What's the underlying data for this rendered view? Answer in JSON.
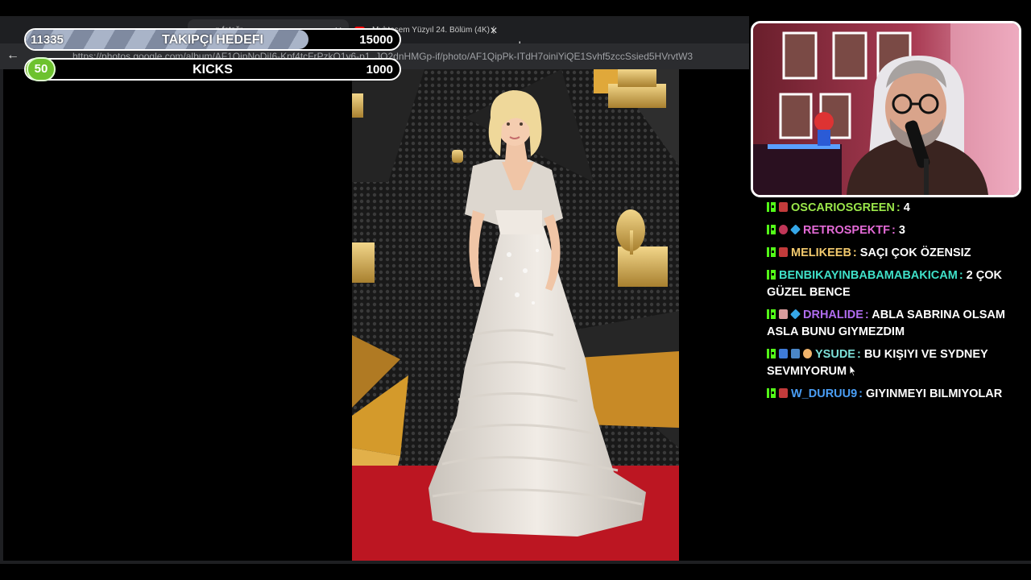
{
  "browser": {
    "tabs": [
      {
        "label": "...n fotoğr",
        "active": true
      },
      {
        "label": "Muhteşem Yüzyıl 24. Bölüm (4K) (",
        "active": false
      }
    ],
    "url": "https://photos.google.com/album/AF1QipNoDiI6-Kpf4tcFrPzkQ1y6-p1_JO2dnHMGp-if/photo/AF1QipPk-ITdH7oiniYiQE1Svhf5zccSsied5HVrvtW3"
  },
  "goals": {
    "follower": {
      "current": "11335",
      "title": "TAKIPÇI HEDEFI",
      "target": "15000",
      "progress": 0.756
    },
    "kicks": {
      "current": "50",
      "title": "KICKS",
      "target": "1000",
      "progress": 0.05
    }
  },
  "photo": {
    "description_icon": "red-carpet-photo"
  },
  "chat": [
    {
      "badges": [
        "kick",
        "tlc"
      ],
      "user": "OSCARIOSGREEN",
      "color": "#9ae64a",
      "text": "4"
    },
    {
      "badges": [
        "kick",
        "rose",
        "cube"
      ],
      "user": "RETROSPEKTF",
      "color": "#e36ad6",
      "text": "3"
    },
    {
      "badges": [
        "kick",
        "tlc"
      ],
      "user": "MELIKEEB",
      "color": "#f2c96d",
      "text": "SAÇI ÇOK ÖZENSIZ"
    },
    {
      "badges": [
        "kick"
      ],
      "user": "BENBIKAYINBABAMABAKICAM",
      "color": "#3fe0c8",
      "text": "2 ÇOK GÜZEL BENCE"
    },
    {
      "badges": [
        "kick",
        "glasses",
        "cube"
      ],
      "user": "DRHALIDE",
      "color": "#b06cf0",
      "text": "ABLA SABRINA OLSAM ASLA BUNU GIYMEZDIM"
    },
    {
      "badges": [
        "kick",
        "sword",
        "mask",
        "arm"
      ],
      "user": "YSUDE",
      "color": "#7de0d8",
      "text": "BU KIŞIYI VE SYDNEY SEVMIYORUM"
    },
    {
      "badges": [
        "kick",
        "tlc"
      ],
      "user": "W_DURUU9",
      "color": "#4a9ef5",
      "text": "GIYINMEYI BILMIYOLAR"
    }
  ],
  "colors": {
    "kick": "#53fc18",
    "goal_kicks_fill": "#7ab828",
    "webcam_border": "#ffffff"
  }
}
